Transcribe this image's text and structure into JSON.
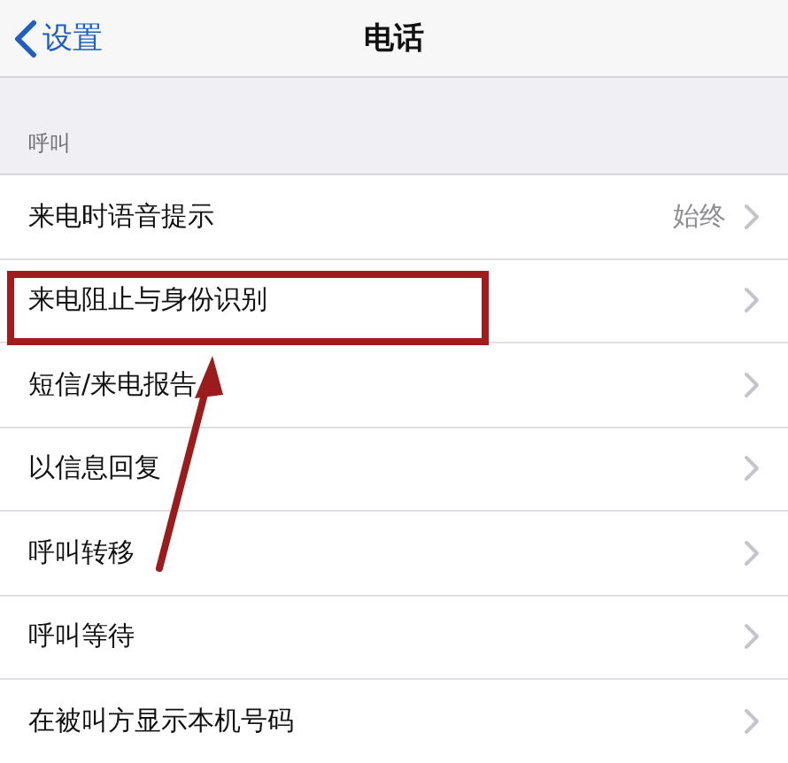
{
  "nav_bar": {
    "back_label": "设置",
    "title": "电话"
  },
  "section": {
    "header": "呼叫"
  },
  "rows": [
    {
      "label": "来电时语音提示",
      "value": "始终",
      "highlighted": false
    },
    {
      "label": "来电阻止与身份识别",
      "highlighted": true
    },
    {
      "label": "短信/来电报告",
      "highlighted": false
    },
    {
      "label": "以信息回复",
      "highlighted": false
    },
    {
      "label": "呼叫转移",
      "highlighted": false
    },
    {
      "label": "呼叫等待",
      "highlighted": false
    },
    {
      "label": "在被叫方显示本机号码",
      "highlighted": false
    }
  ]
}
